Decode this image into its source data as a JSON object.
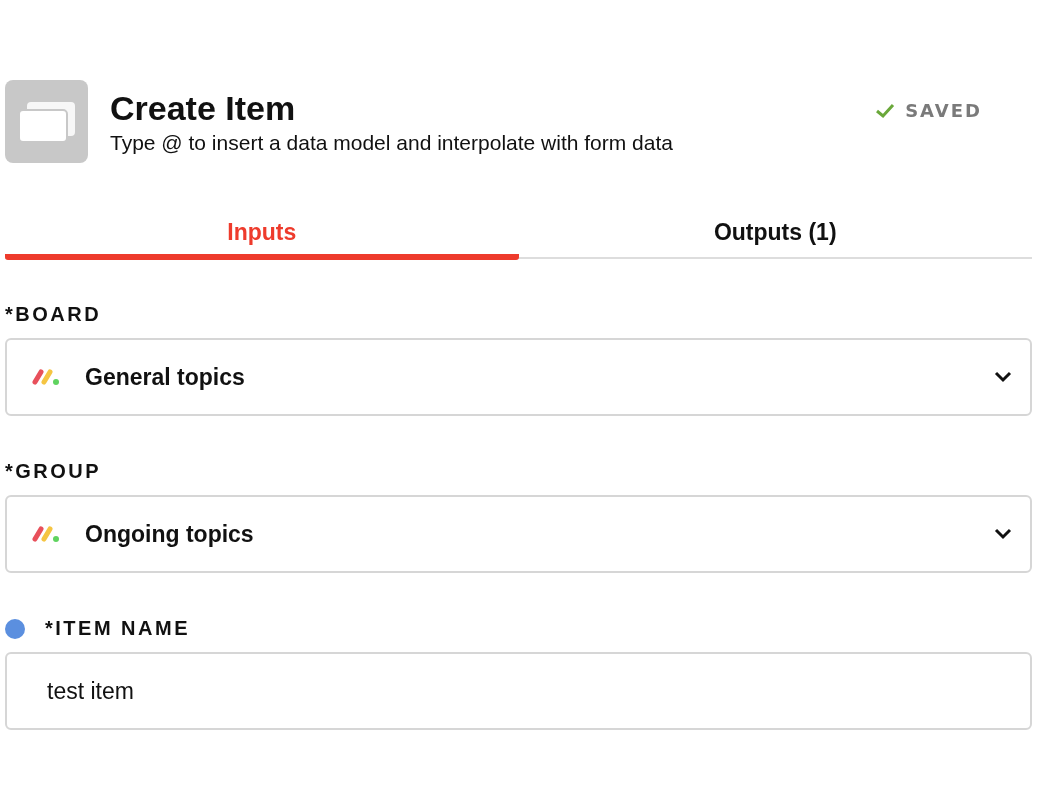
{
  "header": {
    "title": "Create Item",
    "subtitle": "Type @ to insert a data model and interpolate with form data",
    "status": "SAVED"
  },
  "tabs": [
    {
      "label": "Inputs",
      "selected": true
    },
    {
      "label": "Outputs (1)",
      "selected": false
    }
  ],
  "fields": [
    {
      "kind": "select",
      "label": "*BOARD",
      "value": "General topics"
    },
    {
      "kind": "select",
      "label": "*GROUP",
      "value": "Ongoing topics"
    },
    {
      "kind": "text",
      "label": "*ITEM NAME",
      "value": "test item",
      "color": "#5b8fdf"
    }
  ]
}
